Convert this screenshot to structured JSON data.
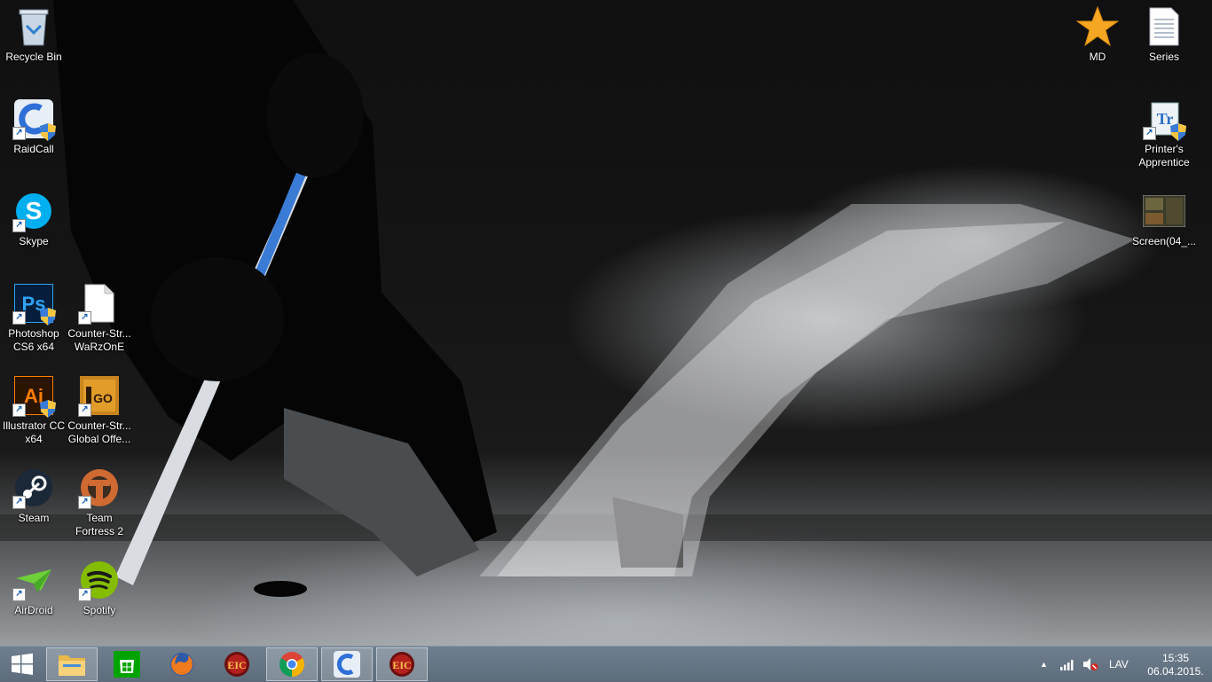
{
  "desktop_icons": [
    {
      "id": "recycle-bin",
      "label": "Recycle Bin",
      "icon": "recycle-bin-icon"
    },
    {
      "id": "raidcall",
      "label": "RaidCall",
      "icon": "raidcall-icon"
    },
    {
      "id": "skype",
      "label": "Skype",
      "icon": "skype-icon"
    },
    {
      "id": "photoshop",
      "label": "Photoshop\nCS6 x64",
      "icon": "photoshop-icon"
    },
    {
      "id": "cs-warzone",
      "label": "Counter-Str...\nWaRzOnE",
      "icon": "blank-file-icon"
    },
    {
      "id": "illustrator",
      "label": "Illustrator CC\nx64",
      "icon": "illustrator-icon"
    },
    {
      "id": "csgo",
      "label": "Counter-Str...\nGlobal Offe...",
      "icon": "csgo-icon"
    },
    {
      "id": "steam",
      "label": "Steam",
      "icon": "steam-icon"
    },
    {
      "id": "tf2",
      "label": "Team\nFortress 2",
      "icon": "tf2-icon"
    },
    {
      "id": "airdroid",
      "label": "AirDroid",
      "icon": "airdroid-icon"
    },
    {
      "id": "spotify",
      "label": "Spotify",
      "icon": "spotify-icon"
    },
    {
      "id": "md",
      "label": "MD",
      "icon": "star-icon"
    },
    {
      "id": "series",
      "label": "Series",
      "icon": "text-file-icon"
    },
    {
      "id": "printers-apprentice",
      "label": "Printer's\nApprentice",
      "icon": "printers-apprentice-icon"
    },
    {
      "id": "screenshot",
      "label": "Screen(04_...",
      "icon": "image-thumbnail-icon"
    }
  ],
  "taskbar": {
    "pinned": [
      {
        "id": "start",
        "icon": "windows-start-icon"
      },
      {
        "id": "file-explorer",
        "icon": "file-explorer-icon",
        "active": true
      },
      {
        "id": "store",
        "icon": "windows-store-icon"
      },
      {
        "id": "firefox",
        "icon": "firefox-icon"
      },
      {
        "id": "game-app-1",
        "icon": "game-badge-icon"
      },
      {
        "id": "chrome",
        "icon": "chrome-icon",
        "active": true
      },
      {
        "id": "raidcall",
        "icon": "raidcall-icon",
        "active": true
      },
      {
        "id": "game-app-2",
        "icon": "game-badge-icon",
        "active": true
      }
    ],
    "tray": {
      "language": "LAV",
      "time": "15:35",
      "date": "06.04.2015."
    }
  }
}
